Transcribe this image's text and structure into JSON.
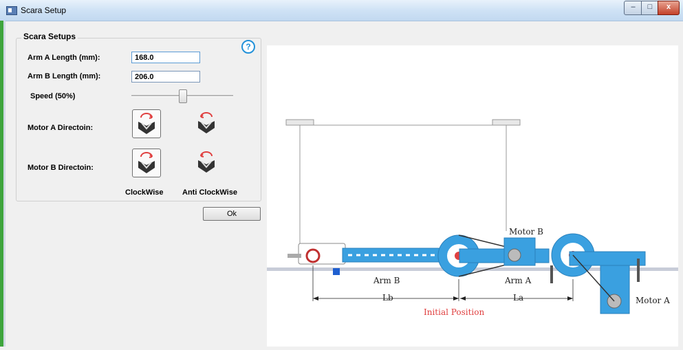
{
  "window": {
    "title": "Scara Setup",
    "min_label": "–",
    "max_label": "□",
    "close_label": "x"
  },
  "setup": {
    "group_title": "Scara Setups",
    "help_icon": "?",
    "arm_a_label": "Arm A Length (mm):",
    "arm_a_value": "168.0",
    "arm_b_label": "Arm B Length (mm):",
    "arm_b_value": "206.0",
    "speed_label": "Speed (50%)",
    "speed_value": 50,
    "motor_a_label": "Motor A Directoin:",
    "motor_b_label": "Motor B Directoin:",
    "clockwise_label": "ClockWise",
    "anticlockwise_label": "Anti ClockWise",
    "motor_a_selected": "ClockWise",
    "motor_b_selected": "ClockWise",
    "ok_label": "Ok"
  },
  "diagram": {
    "arm_b": "Arm B",
    "arm_a": "Arm A",
    "lb": "Lb",
    "la": "La",
    "motor_b": "Motor B",
    "motor_a": "Motor A",
    "initial_position": "Initial Position",
    "accent_blue": "#3aa0e0",
    "accent_red": "#e04040"
  }
}
